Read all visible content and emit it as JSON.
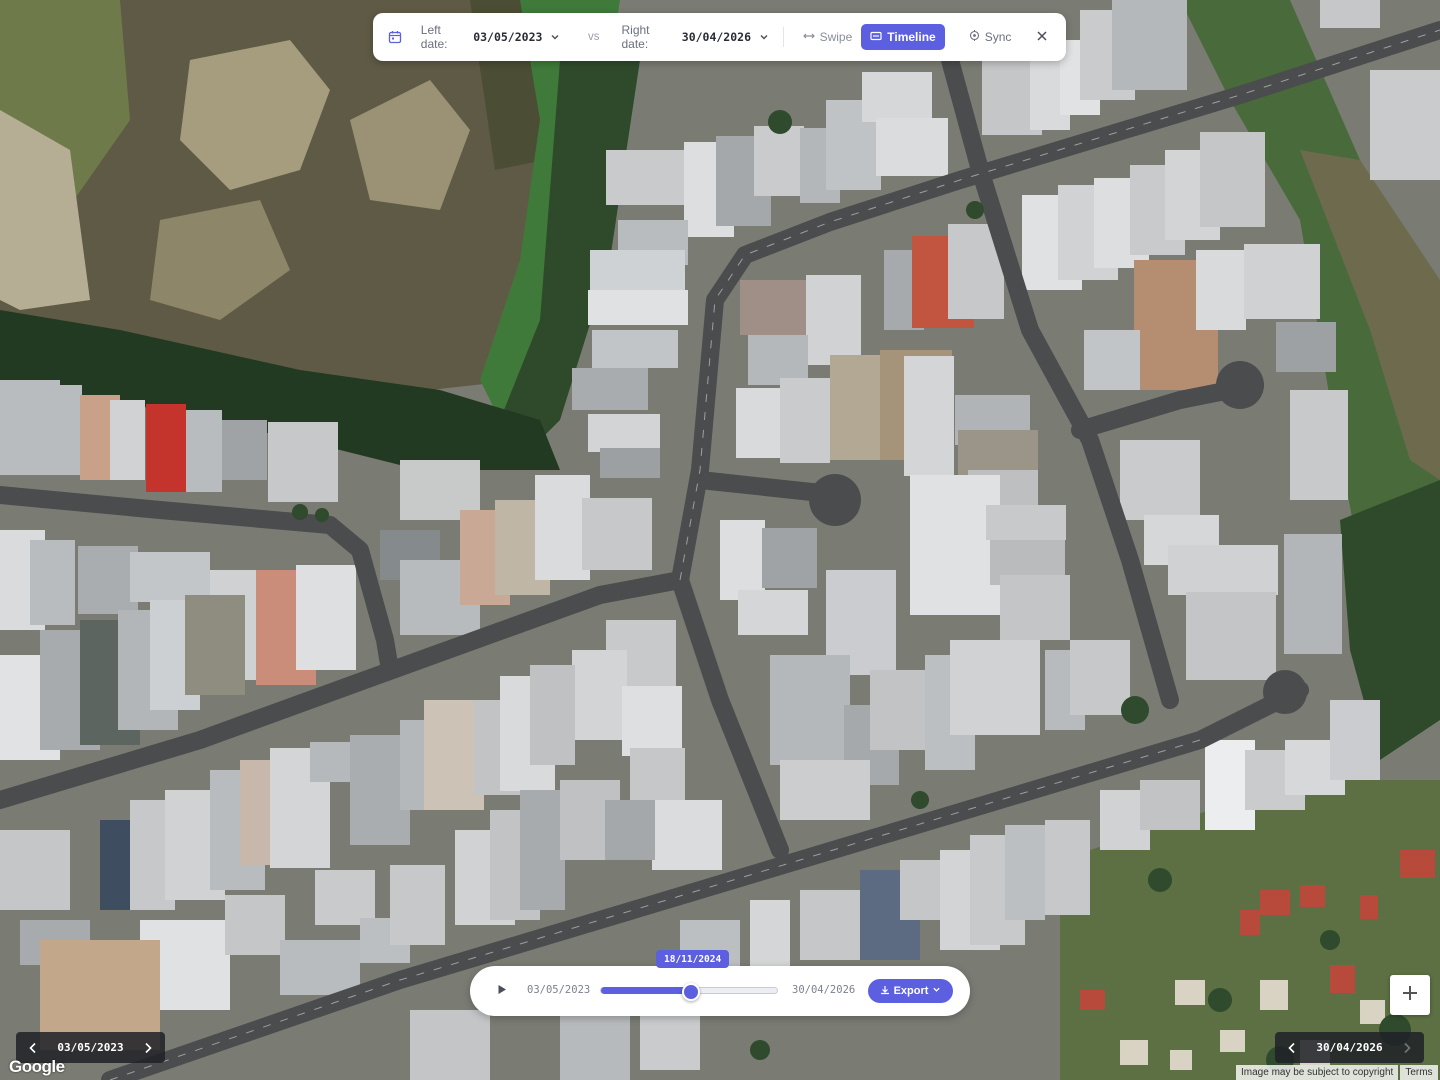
{
  "compare_bar": {
    "left_label": "Left date:",
    "left_date": "03/05/2023",
    "vs_label": "vs",
    "right_label": "Right date:",
    "right_date": "30/04/2026",
    "swipe_label": "Swipe",
    "timeline_label": "Timeline",
    "sync_label": "Sync",
    "active_mode": "Timeline",
    "icons": [
      "calendar-icon",
      "chevron-down-icon",
      "swap-arrows-icon",
      "timeline-icon",
      "sync-target-icon",
      "close-icon"
    ]
  },
  "timeline": {
    "start_date": "03/05/2023",
    "end_date": "30/04/2026",
    "current_date": "18/11/2024",
    "progress": 0.51,
    "export_label": "Export",
    "icons": [
      "play-icon",
      "download-icon",
      "chevron-down-icon"
    ]
  },
  "left_nav": {
    "date": "03/05/2023"
  },
  "right_nav": {
    "date": "30/04/2026",
    "next_disabled": true
  },
  "map": {
    "zoom_in_label": "+",
    "logo": "Google",
    "attribution": "Image may be subject to copyright",
    "terms": "Terms"
  },
  "colors": {
    "accent": "#5b5fe0",
    "panel": "#ffffff",
    "nav_pill": "#202228"
  }
}
